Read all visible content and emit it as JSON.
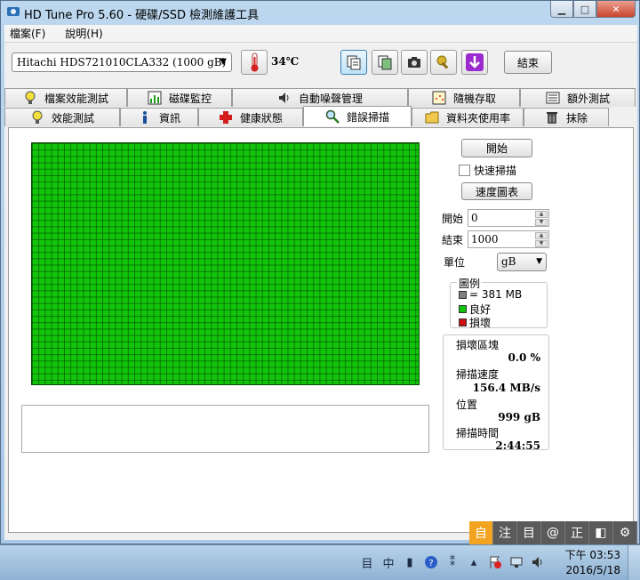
{
  "window": {
    "title": "HD Tune Pro 5.60 - 硬碟/SSD 檢測維護工具"
  },
  "menu": [
    {
      "label": "檔案(F)"
    },
    {
      "label": "說明(H)"
    }
  ],
  "toolbar": {
    "drive": "Hitachi HDS721010CLA332 (1000 gB)",
    "temperature": "34℃",
    "exit_label": "結束"
  },
  "tabs_top": [
    {
      "label": "檔案效能測試",
      "icon": "file-benchmark-icon"
    },
    {
      "label": "磁碟監控",
      "icon": "disk-monitor-icon"
    },
    {
      "label": "自動噪聲管理",
      "icon": "speaker-icon"
    },
    {
      "label": "隨機存取",
      "icon": "random-access-icon"
    },
    {
      "label": "額外測試",
      "icon": "extra-tests-icon"
    }
  ],
  "tabs_bottom": [
    {
      "label": "效能測試",
      "icon": "lightbulb-icon"
    },
    {
      "label": "資訊",
      "icon": "info-icon"
    },
    {
      "label": "健康狀態",
      "icon": "health-cross-icon"
    },
    {
      "label": "錯誤掃描",
      "icon": "magnifier-icon"
    },
    {
      "label": "資料夾使用率",
      "icon": "folder-icon"
    },
    {
      "label": "抹除",
      "icon": "trash-icon"
    }
  ],
  "scan": {
    "start_button": "開始",
    "quick_scan_label": "快速掃描",
    "quick_scan_checked": false,
    "speed_chart_button": "速度圖表",
    "start_label": "開始",
    "start_value": "0",
    "end_label": "結束",
    "end_value": "1000",
    "unit_label": "單位",
    "unit_value": "gB",
    "legend_title": "圖例",
    "legend": [
      {
        "label": "= 381 MB",
        "color": "#808080"
      },
      {
        "label": "良好",
        "color": "#12c40a"
      },
      {
        "label": "損壞",
        "color": "#cc1010"
      }
    ],
    "stats": {
      "damaged_label": "損壞區塊",
      "damaged_value": "0.0 %",
      "speed_label": "掃描速度",
      "speed_value": "156.4 MB/s",
      "position_label": "位置",
      "position_value": "999 gB",
      "time_label": "掃描時間",
      "time_value": "2:44:55"
    },
    "grid_color_good": "#12c40a"
  },
  "ime": [
    "自",
    "注",
    "目",
    "@",
    "正",
    "◧",
    "⚙"
  ],
  "taskbar": {
    "input_icons": [
      "目",
      "中"
    ],
    "time": "下午 03:53",
    "date": "2016/5/18"
  }
}
